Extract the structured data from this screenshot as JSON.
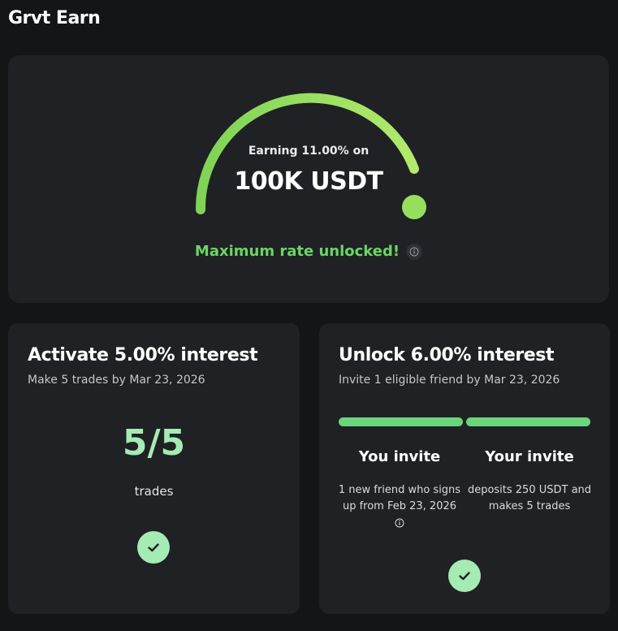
{
  "header": {
    "title": "Grvt Earn"
  },
  "hero": {
    "earning_label": "Earning 11.00% on",
    "amount": "100K USDT",
    "status": "Maximum rate unlocked!",
    "gauge_progress": 1.0,
    "colors": {
      "start": "#7fd356",
      "end": "#b3ea6c",
      "status": "#6bd564"
    }
  },
  "trade_card": {
    "title": "Activate 5.00% interest",
    "subtitle": "Make 5 trades by Mar 23, 2026",
    "progress_text": "5/5",
    "progress_unit": "trades",
    "completed": true,
    "icons": {
      "status": "check-icon"
    }
  },
  "invite_card": {
    "title": "Unlock 6.00% interest",
    "subtitle": "Invite 1 eligible friend by Mar 23, 2026",
    "step_progress": [
      1.0,
      1.0
    ],
    "steps": [
      {
        "title": "You invite",
        "line1": "1 new friend who signs",
        "line2": "up from Feb 23, 2026"
      },
      {
        "title": "Your invite",
        "line1": "deposits 250 USDT and",
        "line2": "makes 5 trades"
      }
    ],
    "completed": true,
    "icons": {
      "status": "check-icon",
      "info": "info-icon"
    }
  },
  "theme": {
    "background": "#141517",
    "card": "#1f2124",
    "accent": "#a5ebb4",
    "bar": "#6bd57b"
  }
}
